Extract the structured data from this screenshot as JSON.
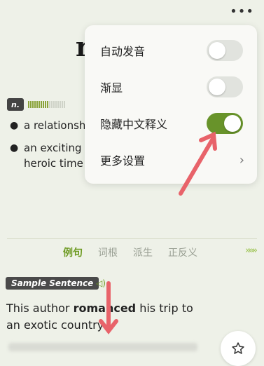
{
  "header": {
    "more_label": "•••"
  },
  "word": {
    "headword": "r"
  },
  "pos": {
    "label": "n."
  },
  "definitions": [
    {
      "text": "a relationsh"
    },
    {
      "text": "an exciting a heroic time"
    }
  ],
  "menu": {
    "items": [
      {
        "label": "自动发音",
        "type": "toggle",
        "on": false
      },
      {
        "label": "渐显",
        "type": "toggle",
        "on": false
      },
      {
        "label": "隐藏中文释义",
        "type": "toggle",
        "on": true
      },
      {
        "label": "更多设置",
        "type": "link"
      }
    ],
    "chevron": "›"
  },
  "tabs": {
    "items": [
      {
        "label": "例句",
        "active": true
      },
      {
        "label": "词根",
        "active": false
      },
      {
        "label": "派生",
        "active": false
      },
      {
        "label": "正反义",
        "active": false
      }
    ],
    "arrows": "»»»"
  },
  "sample": {
    "badge": "Sample Sentence",
    "sound": "◁)",
    "before": "This author ",
    "bold": "romanced",
    "after": " his trip to an exotic country"
  },
  "colors": {
    "accent": "#6d9a22",
    "toggle_on": "#68932a",
    "annotation": "#e8636a"
  },
  "frequency": {
    "filled": 10,
    "total": 18
  }
}
